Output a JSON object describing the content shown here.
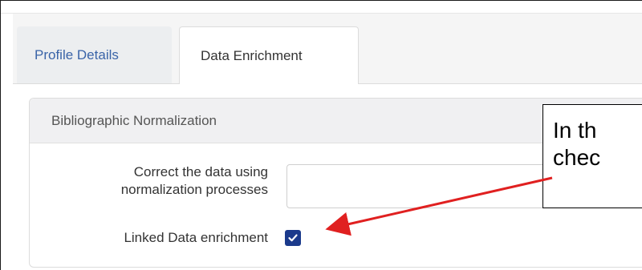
{
  "tabs": [
    {
      "label": "Profile Details",
      "active": false
    },
    {
      "label": "Data Enrichment",
      "active": true
    }
  ],
  "section": {
    "title": "Bibliographic Normalization"
  },
  "fields": {
    "correct_label": "Correct the data using\nnormalization processes",
    "correct_value": "",
    "linked_label": "Linked Data enrichment",
    "linked_checked": true
  },
  "callout": {
    "text": "In th\nchec"
  },
  "colors": {
    "tab_link": "#3a64a8",
    "checkbox": "#1b3a8c",
    "arrow": "#e02020"
  },
  "icons": {
    "checkbox": "checkmark-icon"
  }
}
